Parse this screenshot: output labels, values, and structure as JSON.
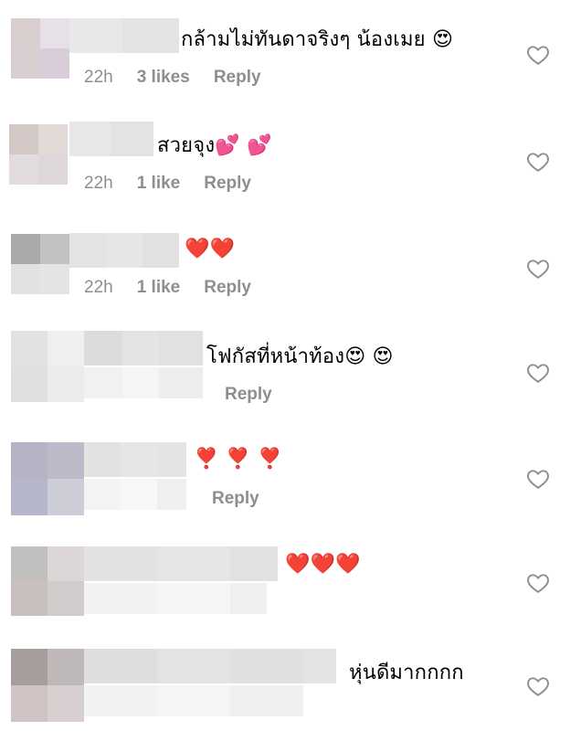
{
  "comments": [
    {
      "text": "กล้ามไม่ทันดาจริงๆ น้องเมย",
      "emoji": "😍",
      "time": "22h",
      "likes": "3 likes",
      "reply": "Reply"
    },
    {
      "text": "สวยจุง",
      "emoji": "💕 💕",
      "time": "22h",
      "likes": "1 like",
      "reply": "Reply"
    },
    {
      "text": "",
      "emoji": "❤️❤️",
      "time": "22h",
      "likes": "1 like",
      "reply": "Reply"
    },
    {
      "text": "โฟกัสที่หน้าท้อง",
      "emoji": "😍 😍",
      "time": "",
      "likes": "",
      "reply": "Reply"
    },
    {
      "text": "",
      "emoji": "❣️ ❣️ ❣️",
      "time": "",
      "likes": "",
      "reply": "Reply"
    },
    {
      "text": "",
      "emoji": "❤️❤️❤️",
      "time": "",
      "likes": "",
      "reply": ""
    },
    {
      "text": "หุ่นดีมากกกก",
      "emoji": "",
      "time": "",
      "likes": "",
      "reply": ""
    }
  ],
  "icons": {
    "like": "heart-outline-icon"
  },
  "colors": {
    "meta": "#8e8e8e",
    "heart_red": "#d0021b"
  }
}
